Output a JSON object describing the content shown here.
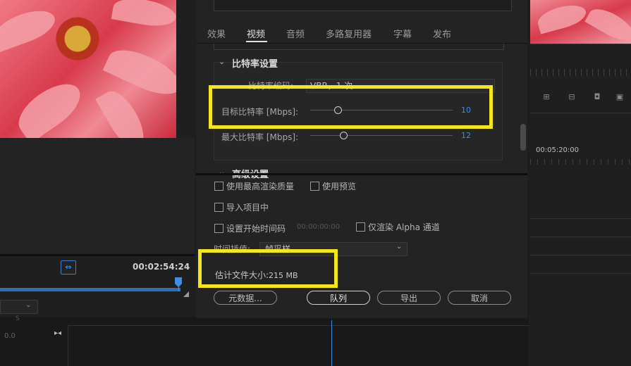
{
  "left_monitor": {
    "timecode": "00:02:54:24",
    "track_label_0": "0.0",
    "track_label_s": "S"
  },
  "right_monitor": {
    "timecode": "00:05:20:00"
  },
  "dialog": {
    "tabs": [
      "效果",
      "视频",
      "音频",
      "多路复用器",
      "字幕",
      "发布"
    ],
    "active_tab": "视频",
    "bitrate_section": {
      "title": "比特率设置",
      "encoding_label": "比特率编码:",
      "encoding_value": "VBR，1 次",
      "target_label": "目标比特率 [Mbps]:",
      "target_value": "10",
      "target_level": 0.2,
      "max_label": "最大比特率 [Mbps]:",
      "max_value": "12",
      "max_level": 0.24
    },
    "advanced_title": "高级设置",
    "options": {
      "max_render_quality": "使用最高渲染质量",
      "use_previews": "使用预览",
      "import_into_project": "导入项目中",
      "set_start_timecode": "设置开始时间码",
      "start_timecode_value": "00:00:00:00",
      "render_alpha_only": "仅渲染 Alpha 通道"
    },
    "interpolation_label": "时间插值:",
    "interpolation_value": "帧采样",
    "estimated_size_label": "估计文件大小:",
    "estimated_size_value": "215 MB",
    "buttons": {
      "metadata": "元数据...",
      "queue": "队列",
      "export": "导出",
      "cancel": "取消"
    }
  },
  "colors": {
    "highlight": "#f5e61a",
    "accent": "#3b8fe0"
  }
}
